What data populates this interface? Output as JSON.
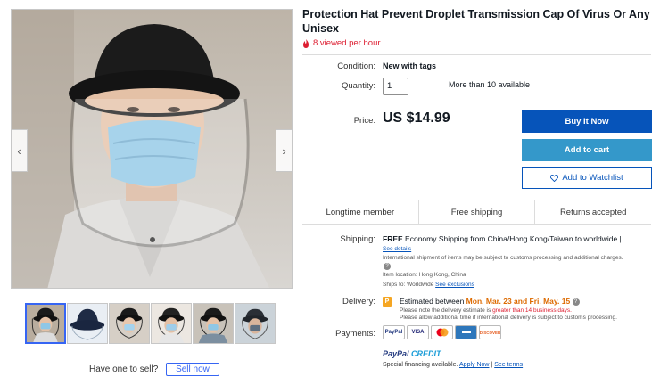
{
  "gallery": {
    "prev_icon": "chevron-left-icon",
    "next_icon": "chevron-right-icon",
    "prev_glyph": "‹",
    "next_glyph": "›",
    "thumbnail_count": 6,
    "selected_index": 0
  },
  "sell_prompt": {
    "text": "Have one to sell?",
    "button": "Sell now"
  },
  "listing": {
    "title": "Protection Hat Prevent Droplet Transmission Cap Of Virus Or Any Unisex",
    "views_text": "8 viewed per hour",
    "views_icon": "fire-icon",
    "condition_label": "Condition:",
    "condition_value": "New with tags",
    "quantity_label": "Quantity:",
    "quantity_value": "1",
    "availability": "More than 10 available",
    "price_label": "Price:",
    "price": "US $14.99"
  },
  "actions": {
    "buy_now": "Buy It Now",
    "add_to_cart": "Add to cart",
    "add_to_watchlist": "Add to Watchlist",
    "watch_icon": "heart-icon"
  },
  "features": [
    "Longtime member",
    "Free shipping",
    "Returns accepted"
  ],
  "shipping": {
    "label": "Shipping:",
    "free": "FREE",
    "method": "Economy Shipping from China/Hong Kong/Taiwan to worldwide |",
    "see_details": "See details",
    "customs_note": "International shipment of items may be subject to customs processing and additional charges.",
    "info_icon": "info-icon",
    "item_location": "Item location:  Hong Kong, China",
    "ships_to_label": "Ships to:",
    "ships_to_value": "Worldwide",
    "see_exclusions": "See exclusions"
  },
  "delivery": {
    "label": "Delivery:",
    "icon": "delivery-icon",
    "estimated_prefix": "Estimated between",
    "estimated_dates": "Mon. Mar. 23 and Fri. May. 15",
    "note1_prefix": "Please note the delivery estimate is",
    "note1_highlight": "greater than 14 business days.",
    "note2": "Please allow additional time if international delivery is subject to customs processing."
  },
  "payments": {
    "label": "Payments:",
    "logos": [
      "PayPal",
      "VISA",
      "MC",
      "AMEX",
      "DISCOVER"
    ],
    "credit_part1": "PayPal",
    "credit_part2": "CREDIT",
    "financing": "Special financing available.",
    "apply_now": "Apply Now",
    "see_terms": "See terms"
  },
  "colors": {
    "buy_now": "#0654ba",
    "add_to_cart": "#3498ca",
    "views": "#dd1e31",
    "delivery_highlight": "#dd6a00"
  }
}
